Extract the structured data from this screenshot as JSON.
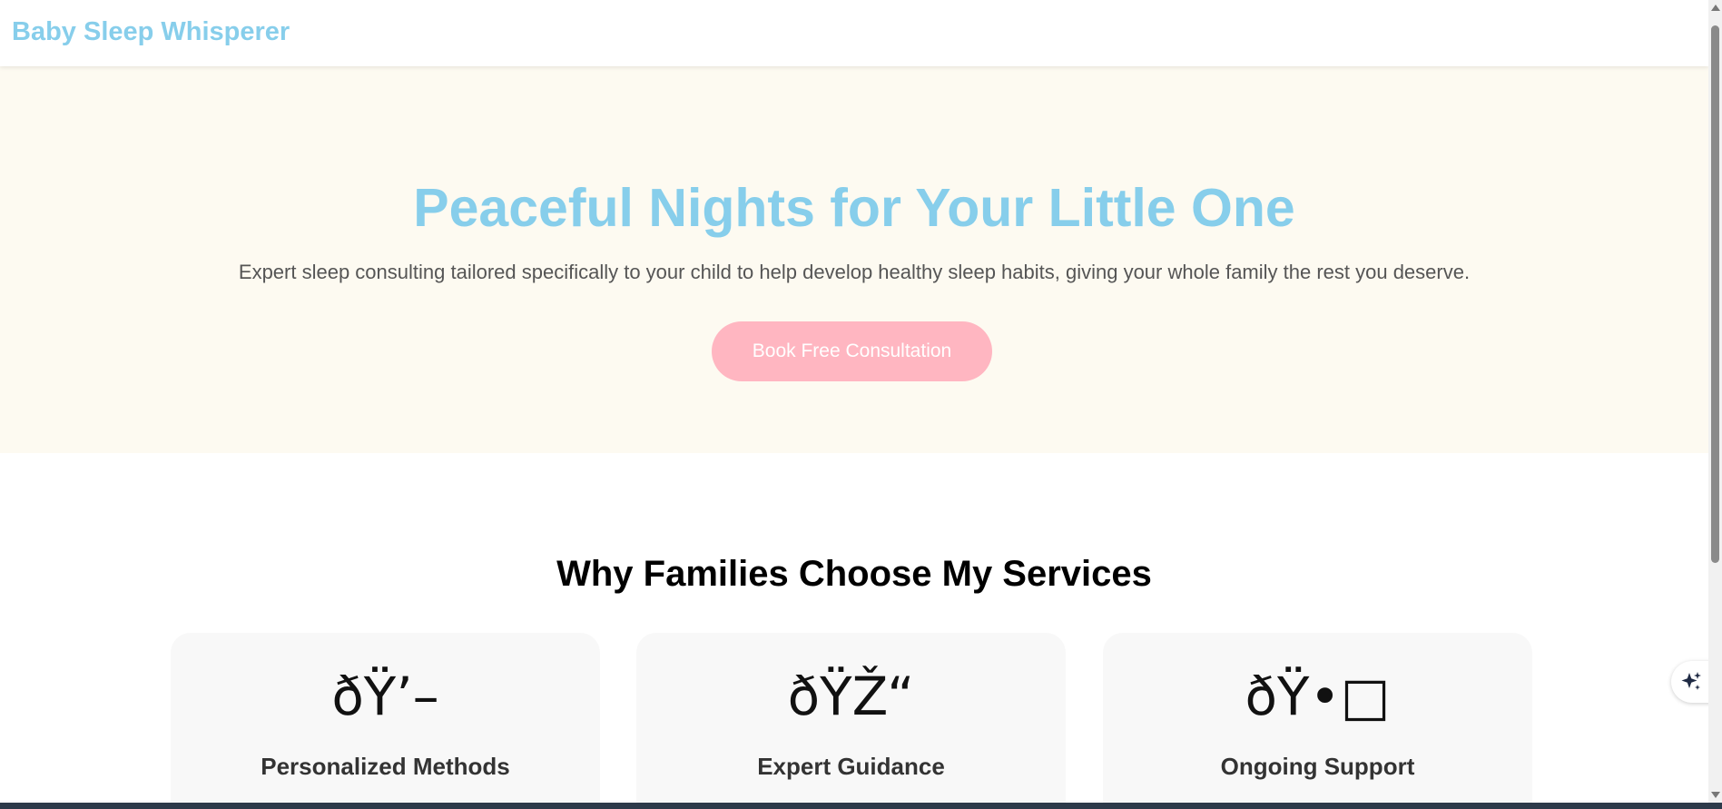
{
  "header": {
    "logo": "Baby Sleep Whisperer"
  },
  "hero": {
    "title": "Peaceful Nights for Your Little One",
    "subtitle": "Expert sleep consulting tailored specifically to your child to help develop healthy sleep habits, giving your whole family the rest you deserve.",
    "cta_label": "Book Free Consultation"
  },
  "features": {
    "title": "Why Families Choose My Services",
    "cards": [
      {
        "icon": "ðŸ’–",
        "title": "Personalized Methods"
      },
      {
        "icon": "ðŸŽ“",
        "title": "Expert Guidance"
      },
      {
        "icon": "ðŸ•□",
        "title": "Ongoing Support"
      }
    ]
  },
  "colors": {
    "brand_blue": "#87ceeb",
    "cta_pink": "#ffb6c1",
    "hero_bg": "#fdfaf1",
    "card_bg": "#f8f8f8"
  },
  "icons": {
    "assistant": "sparkle-icon"
  }
}
